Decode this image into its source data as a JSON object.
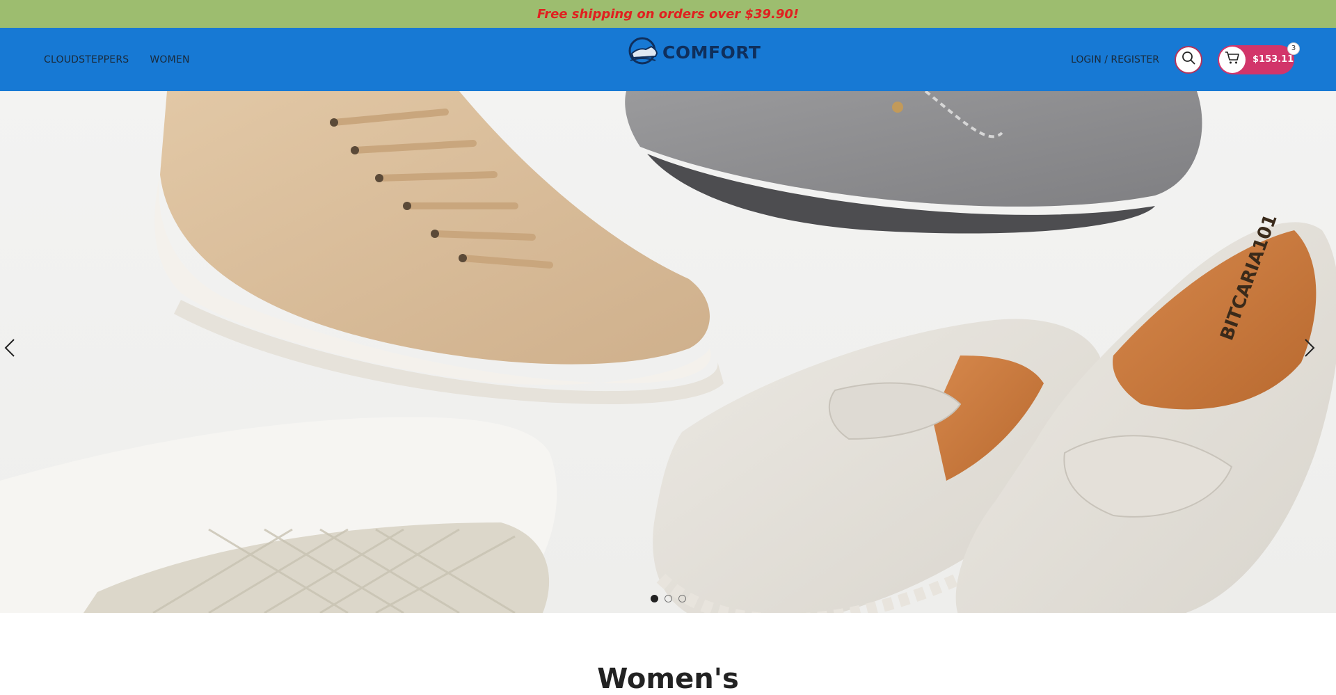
{
  "promo": {
    "text": "Free shipping on orders over $39.90!"
  },
  "header": {
    "nav": [
      {
        "label": "CLOUDSTEPPERS"
      },
      {
        "label": "WOMEN"
      }
    ],
    "logo_text": "COMFORT",
    "login_label": "LOGIN / REGISTER",
    "cart": {
      "total": "$153.11",
      "count": "3"
    },
    "icons": {
      "search": "search-icon",
      "cart": "cart-icon",
      "logo": "shoe-logo-icon"
    }
  },
  "hero": {
    "slides_count": 3,
    "active_slide": 1,
    "shoe_sole_text": "BITCARIA101"
  },
  "section": {
    "title": "Women's"
  },
  "colors": {
    "promo_bg": "#9dbd6f",
    "promo_text": "#e02020",
    "header_bg": "#1779d4",
    "cart_bg": "#d2356a"
  }
}
